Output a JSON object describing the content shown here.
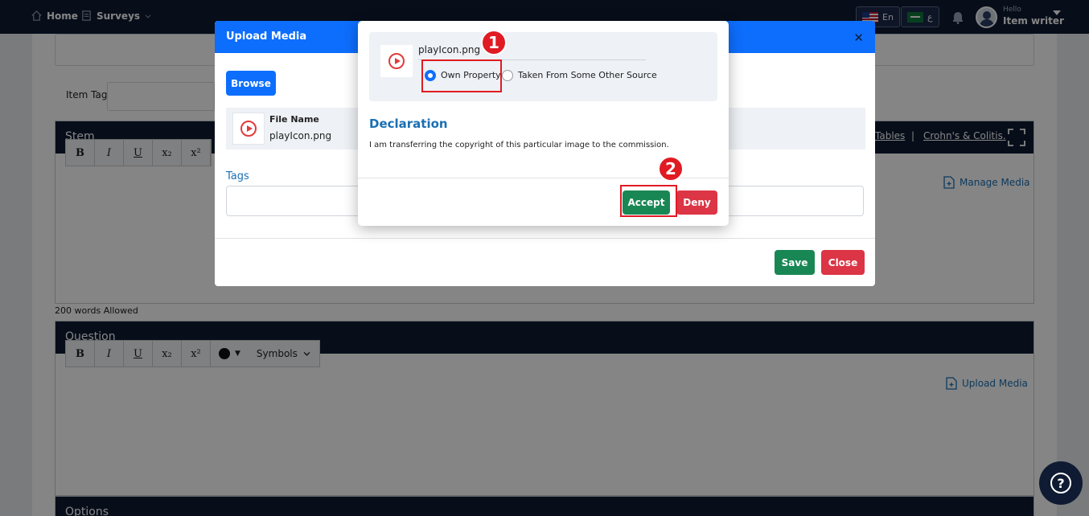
{
  "nav": {
    "home": "Home",
    "surveys": "Surveys",
    "lang_en": "En",
    "lang_ar": "ع",
    "greeting": "Hello",
    "user": "Item writer"
  },
  "page": {
    "item_tag_label": "Item Tag",
    "stem_title": "Stem",
    "stem_links": [
      "Tables",
      "|",
      "Crohn's & Colitis."
    ],
    "manage_media": "Manage Media",
    "words_allowed": "200 words Allowed",
    "question_title": "Question",
    "upload_media_link": "Upload Media",
    "symbols": "Symbols",
    "options_title": "Options",
    "toolbar": [
      "B",
      "I",
      "U",
      "x₂",
      "x²"
    ]
  },
  "upload_modal": {
    "title": "Upload Media",
    "close": "✕",
    "browse": "Browse",
    "file_name_label": "File Name",
    "file_name": "playIcon.png",
    "tags_label": "Tags",
    "save": "Save",
    "close_btn": "Close"
  },
  "declaration_modal": {
    "file_name": "playIcon.png",
    "option_own": "Own Property",
    "option_other": "Taken From Some Other Source",
    "heading": "Declaration",
    "text": "I am transferring the copyright of this particular image to the commission.",
    "accept": "Accept",
    "deny": "Deny",
    "step1": "1",
    "step2": "2"
  },
  "help": "?",
  "colors": {
    "nav_bg": "#0f1b33",
    "primary": "#0d6efd",
    "accept": "#198754",
    "deny": "#dc3545",
    "annotation": "#e01b24"
  }
}
